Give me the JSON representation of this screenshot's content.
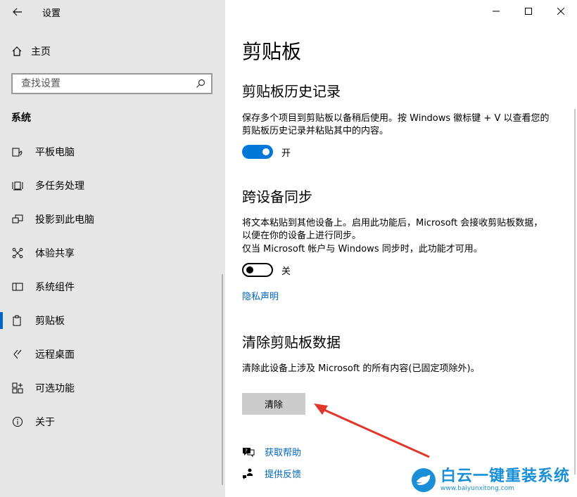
{
  "sidebar": {
    "title": "设置",
    "home_label": "主页",
    "search_placeholder": "查找设置",
    "section": "系统",
    "items": [
      {
        "label": "平板电脑",
        "icon": "tablet-icon"
      },
      {
        "label": "多任务处理",
        "icon": "multitasking-icon"
      },
      {
        "label": "投影到此电脑",
        "icon": "project-icon"
      },
      {
        "label": "体验共享",
        "icon": "share-icon"
      },
      {
        "label": "系统组件",
        "icon": "components-icon"
      },
      {
        "label": "剪贴板",
        "icon": "clipboard-icon",
        "active": true
      },
      {
        "label": "远程桌面",
        "icon": "remote-desktop-icon"
      },
      {
        "label": "可选功能",
        "icon": "optional-features-icon"
      },
      {
        "label": "关于",
        "icon": "info-icon"
      }
    ]
  },
  "main": {
    "title": "剪贴板",
    "history": {
      "heading": "剪贴板历史记录",
      "description": "保存多个项目到剪贴板以备稍后使用。按 Windows 徽标键 + V 以查看您的剪贴板历史记录并粘贴其中的内容。",
      "toggle_state": "开"
    },
    "sync": {
      "heading": "跨设备同步",
      "description": "将文本粘贴到其他设备上。启用此功能后，Microsoft 会接收剪贴板数据，以便在你的设备上进行同步。",
      "note": "仅当 Microsoft 帐户与 Windows 同步时，此功能才可用。",
      "toggle_state": "关",
      "privacy_link": "隐私声明"
    },
    "clear": {
      "heading": "清除剪贴板数据",
      "description": "清除此设备上涉及 Microsoft 的所有内容(已固定项除外)。",
      "button": "清除"
    },
    "help_link": "获取帮助",
    "feedback_link": "提供反馈"
  },
  "watermark": {
    "main": "白云一键重装系统",
    "sub": "www.baiyunxitong.com"
  },
  "colors": {
    "accent": "#0078d7",
    "link": "#0067c0",
    "sidebar_bg": "#e6e6e6",
    "arrow": "#e0362c"
  }
}
